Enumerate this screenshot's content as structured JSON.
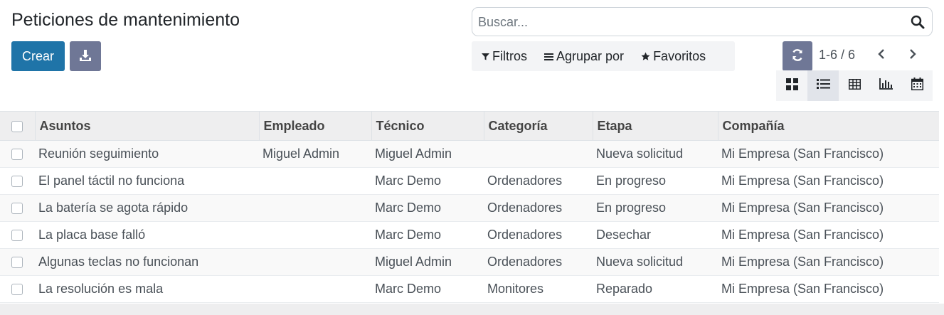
{
  "page": {
    "title": "Peticiones de mantenimiento"
  },
  "toolbar": {
    "create_label": "Crear",
    "download_icon": "download-icon"
  },
  "search": {
    "placeholder": "Buscar...",
    "value": "",
    "icon": "search-icon"
  },
  "filters": {
    "filters_label": "Filtros",
    "group_by_label": "Agrupar por",
    "favorites_label": "Favoritos"
  },
  "pager": {
    "value": "1-6 / 6"
  },
  "views": [
    "kanban",
    "list",
    "pivot",
    "graph",
    "calendar"
  ],
  "active_view": "list",
  "table": {
    "columns": [
      "Asuntos",
      "Empleado",
      "Técnico",
      "Categoría",
      "Etapa",
      "Compañía"
    ],
    "rows": [
      [
        "Reunión seguimiento",
        "Miguel Admin",
        "Miguel Admin",
        "",
        "Nueva solicitud",
        "Mi Empresa (San Francisco)"
      ],
      [
        "El panel táctil no funciona",
        "",
        "Marc Demo",
        "Ordenadores",
        "En progreso",
        "Mi Empresa (San Francisco)"
      ],
      [
        "La batería se agota rápido",
        "",
        "Marc Demo",
        "Ordenadores",
        "En progreso",
        "Mi Empresa (San Francisco)"
      ],
      [
        "La placa base falló",
        "",
        "Marc Demo",
        "Ordenadores",
        "Desechar",
        "Mi Empresa (San Francisco)"
      ],
      [
        "Algunas teclas no funcionan",
        "",
        "Miguel Admin",
        "Ordenadores",
        "Nueva solicitud",
        "Mi Empresa (San Francisco)"
      ],
      [
        "La resolución es mala",
        "",
        "Marc Demo",
        "Monitores",
        "Reparado",
        "Mi Empresa (San Francisco)"
      ]
    ]
  },
  "colors": {
    "primary": "#1f74a8",
    "secondary": "#6f7796",
    "header_bg": "#eeeeef"
  }
}
